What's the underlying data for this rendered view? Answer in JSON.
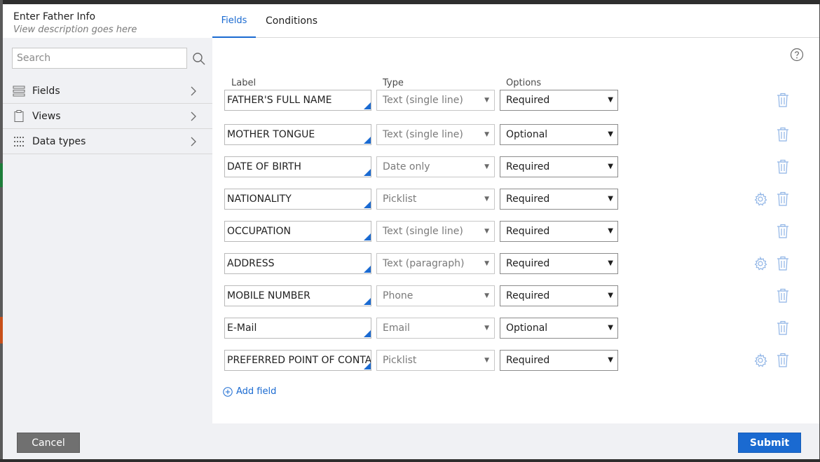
{
  "dialog": {
    "title": "Enter Father Info",
    "description": "View description goes here"
  },
  "search": {
    "placeholder": "Search",
    "value": ""
  },
  "nav": [
    {
      "label": "Fields",
      "icon": "list-icon"
    },
    {
      "label": "Views",
      "icon": "clipboard-icon"
    },
    {
      "label": "Data types",
      "icon": "grid-dots-icon"
    }
  ],
  "tabs": {
    "fields": "Fields",
    "conditions": "Conditions"
  },
  "columns": {
    "label": "Label",
    "type": "Type",
    "options": "Options"
  },
  "rows": [
    {
      "label": "FATHER'S FULL NAME",
      "type": "Text (single line)",
      "option": "Required",
      "gear": false
    },
    {
      "label": "MOTHER TONGUE",
      "type": "Text (single line)",
      "option": "Optional",
      "gear": false
    },
    {
      "label": "DATE OF BIRTH",
      "type": "Date only",
      "option": "Required",
      "gear": false
    },
    {
      "label": "NATIONALITY",
      "type": "Picklist",
      "option": "Required",
      "gear": true
    },
    {
      "label": "OCCUPATION",
      "type": "Text (single line)",
      "option": "Required",
      "gear": false
    },
    {
      "label": "ADDRESS",
      "type": "Text (paragraph)",
      "option": "Required",
      "gear": true
    },
    {
      "label": "MOBILE NUMBER",
      "type": "Phone",
      "option": "Required",
      "gear": false
    },
    {
      "label": "E-Mail",
      "type": "Email",
      "option": "Optional",
      "gear": false
    },
    {
      "label": "PREFERRED POINT OF CONTAC",
      "type": "Picklist",
      "option": "Required",
      "gear": true
    }
  ],
  "add_field": "Add field",
  "footer": {
    "cancel": "Cancel",
    "submit": "Submit"
  },
  "colors": {
    "accent": "#1a6ad1",
    "cancel_bg": "#707070",
    "panel_bg": "#f0f1f4"
  }
}
